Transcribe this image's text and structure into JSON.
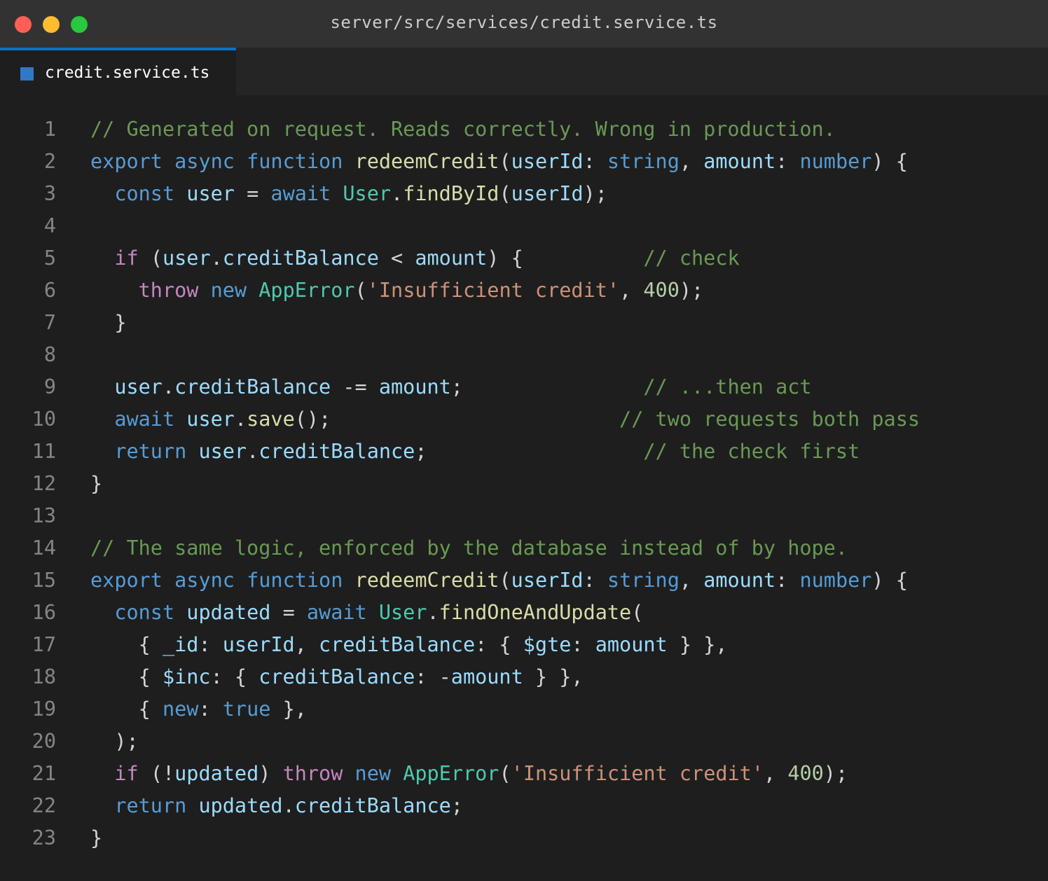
{
  "window": {
    "title": "server/src/services/credit.service.ts"
  },
  "tabs": [
    {
      "label": "credit.service.ts",
      "icon": "typescript-file-icon",
      "active": true
    }
  ],
  "colors": {
    "background": "#1e1e1e",
    "titlebar": "#323233",
    "tab_accent": "#0e70c0",
    "keyword": "#569cd6",
    "control": "#c586c0",
    "function": "#dcdcaa",
    "variable": "#9cdcfe",
    "type": "#4ec9b0",
    "string": "#ce9178",
    "number": "#b5cea8",
    "comment": "#6a9955"
  },
  "editor": {
    "lines": [
      {
        "n": "1",
        "tokens": [
          [
            "cmt",
            "// Generated on request. Reads correctly. Wrong in production."
          ]
        ]
      },
      {
        "n": "2",
        "tokens": [
          [
            "kw",
            "export"
          ],
          [
            "pun",
            " "
          ],
          [
            "kw",
            "async"
          ],
          [
            "pun",
            " "
          ],
          [
            "kw",
            "function"
          ],
          [
            "pun",
            " "
          ],
          [
            "fn",
            "redeemCredit"
          ],
          [
            "pun",
            "("
          ],
          [
            "var",
            "userId"
          ],
          [
            "pun",
            ": "
          ],
          [
            "kw",
            "string"
          ],
          [
            "pun",
            ", "
          ],
          [
            "var",
            "amount"
          ],
          [
            "pun",
            ": "
          ],
          [
            "kw",
            "number"
          ],
          [
            "pun",
            ") {"
          ]
        ]
      },
      {
        "n": "3",
        "tokens": [
          [
            "pun",
            "  "
          ],
          [
            "kw",
            "const"
          ],
          [
            "pun",
            " "
          ],
          [
            "var",
            "user"
          ],
          [
            "pun",
            " = "
          ],
          [
            "kw",
            "await"
          ],
          [
            "pun",
            " "
          ],
          [
            "typ",
            "User"
          ],
          [
            "pun",
            "."
          ],
          [
            "fn",
            "findById"
          ],
          [
            "pun",
            "("
          ],
          [
            "var",
            "userId"
          ],
          [
            "pun",
            ");"
          ]
        ]
      },
      {
        "n": "4",
        "tokens": []
      },
      {
        "n": "5",
        "tokens": [
          [
            "pun",
            "  "
          ],
          [
            "ctl",
            "if"
          ],
          [
            "pun",
            " ("
          ],
          [
            "var",
            "user"
          ],
          [
            "pun",
            "."
          ],
          [
            "var",
            "creditBalance"
          ],
          [
            "pun",
            " < "
          ],
          [
            "var",
            "amount"
          ],
          [
            "pun",
            ") {"
          ],
          [
            "pun",
            "          "
          ],
          [
            "cmt",
            "// check"
          ]
        ]
      },
      {
        "n": "6",
        "tokens": [
          [
            "pun",
            "    "
          ],
          [
            "ctl",
            "throw"
          ],
          [
            "pun",
            " "
          ],
          [
            "kw",
            "new"
          ],
          [
            "pun",
            " "
          ],
          [
            "typ",
            "AppError"
          ],
          [
            "pun",
            "("
          ],
          [
            "str",
            "'Insufficient credit'"
          ],
          [
            "pun",
            ", "
          ],
          [
            "num",
            "400"
          ],
          [
            "pun",
            ");"
          ]
        ]
      },
      {
        "n": "7",
        "tokens": [
          [
            "pun",
            "  }"
          ]
        ]
      },
      {
        "n": "8",
        "tokens": []
      },
      {
        "n": "9",
        "tokens": [
          [
            "pun",
            "  "
          ],
          [
            "var",
            "user"
          ],
          [
            "pun",
            "."
          ],
          [
            "var",
            "creditBalance"
          ],
          [
            "pun",
            " -= "
          ],
          [
            "var",
            "amount"
          ],
          [
            "pun",
            ";"
          ],
          [
            "pun",
            "               "
          ],
          [
            "cmt",
            "// ...then act"
          ]
        ]
      },
      {
        "n": "10",
        "tokens": [
          [
            "pun",
            "  "
          ],
          [
            "kw",
            "await"
          ],
          [
            "pun",
            " "
          ],
          [
            "var",
            "user"
          ],
          [
            "pun",
            "."
          ],
          [
            "fn",
            "save"
          ],
          [
            "pun",
            "();"
          ],
          [
            "pun",
            "                        "
          ],
          [
            "cmt",
            "// two requests both pass"
          ]
        ]
      },
      {
        "n": "11",
        "tokens": [
          [
            "pun",
            "  "
          ],
          [
            "kw",
            "return"
          ],
          [
            "pun",
            " "
          ],
          [
            "var",
            "user"
          ],
          [
            "pun",
            "."
          ],
          [
            "var",
            "creditBalance"
          ],
          [
            "pun",
            ";"
          ],
          [
            "pun",
            "                  "
          ],
          [
            "cmt",
            "// the check first"
          ]
        ]
      },
      {
        "n": "12",
        "tokens": [
          [
            "pun",
            "}"
          ]
        ]
      },
      {
        "n": "13",
        "tokens": []
      },
      {
        "n": "14",
        "tokens": [
          [
            "cmt",
            "// The same logic, enforced by the database instead of by hope."
          ]
        ]
      },
      {
        "n": "15",
        "tokens": [
          [
            "kw",
            "export"
          ],
          [
            "pun",
            " "
          ],
          [
            "kw",
            "async"
          ],
          [
            "pun",
            " "
          ],
          [
            "kw",
            "function"
          ],
          [
            "pun",
            " "
          ],
          [
            "fn",
            "redeemCredit"
          ],
          [
            "pun",
            "("
          ],
          [
            "var",
            "userId"
          ],
          [
            "pun",
            ": "
          ],
          [
            "kw",
            "string"
          ],
          [
            "pun",
            ", "
          ],
          [
            "var",
            "amount"
          ],
          [
            "pun",
            ": "
          ],
          [
            "kw",
            "number"
          ],
          [
            "pun",
            ") {"
          ]
        ]
      },
      {
        "n": "16",
        "tokens": [
          [
            "pun",
            "  "
          ],
          [
            "kw",
            "const"
          ],
          [
            "pun",
            " "
          ],
          [
            "var",
            "updated"
          ],
          [
            "pun",
            " = "
          ],
          [
            "kw",
            "await"
          ],
          [
            "pun",
            " "
          ],
          [
            "typ",
            "User"
          ],
          [
            "pun",
            "."
          ],
          [
            "fn",
            "findOneAndUpdate"
          ],
          [
            "pun",
            "("
          ]
        ]
      },
      {
        "n": "17",
        "tokens": [
          [
            "pun",
            "    { "
          ],
          [
            "var",
            "_id"
          ],
          [
            "pun",
            ": "
          ],
          [
            "var",
            "userId"
          ],
          [
            "pun",
            ", "
          ],
          [
            "var",
            "creditBalance"
          ],
          [
            "pun",
            ": { "
          ],
          [
            "var",
            "$gte"
          ],
          [
            "pun",
            ": "
          ],
          [
            "var",
            "amount"
          ],
          [
            "pun",
            " } },"
          ]
        ]
      },
      {
        "n": "18",
        "tokens": [
          [
            "pun",
            "    { "
          ],
          [
            "var",
            "$inc"
          ],
          [
            "pun",
            ": { "
          ],
          [
            "var",
            "creditBalance"
          ],
          [
            "pun",
            ": -"
          ],
          [
            "var",
            "amount"
          ],
          [
            "pun",
            " } },"
          ]
        ]
      },
      {
        "n": "19",
        "tokens": [
          [
            "pun",
            "    { "
          ],
          [
            "kw",
            "new"
          ],
          [
            "pun",
            ": "
          ],
          [
            "kw",
            "true"
          ],
          [
            "pun",
            " },"
          ]
        ]
      },
      {
        "n": "20",
        "tokens": [
          [
            "pun",
            "  );"
          ]
        ]
      },
      {
        "n": "21",
        "tokens": [
          [
            "pun",
            "  "
          ],
          [
            "ctl",
            "if"
          ],
          [
            "pun",
            " (!"
          ],
          [
            "var",
            "updated"
          ],
          [
            "pun",
            ") "
          ],
          [
            "ctl",
            "throw"
          ],
          [
            "pun",
            " "
          ],
          [
            "kw",
            "new"
          ],
          [
            "pun",
            " "
          ],
          [
            "typ",
            "AppError"
          ],
          [
            "pun",
            "("
          ],
          [
            "str",
            "'Insufficient credit'"
          ],
          [
            "pun",
            ", "
          ],
          [
            "num",
            "400"
          ],
          [
            "pun",
            ");"
          ]
        ]
      },
      {
        "n": "22",
        "tokens": [
          [
            "pun",
            "  "
          ],
          [
            "kw",
            "return"
          ],
          [
            "pun",
            " "
          ],
          [
            "var",
            "updated"
          ],
          [
            "pun",
            "."
          ],
          [
            "var",
            "creditBalance"
          ],
          [
            "pun",
            ";"
          ]
        ]
      },
      {
        "n": "23",
        "tokens": [
          [
            "pun",
            "}"
          ]
        ]
      }
    ]
  }
}
